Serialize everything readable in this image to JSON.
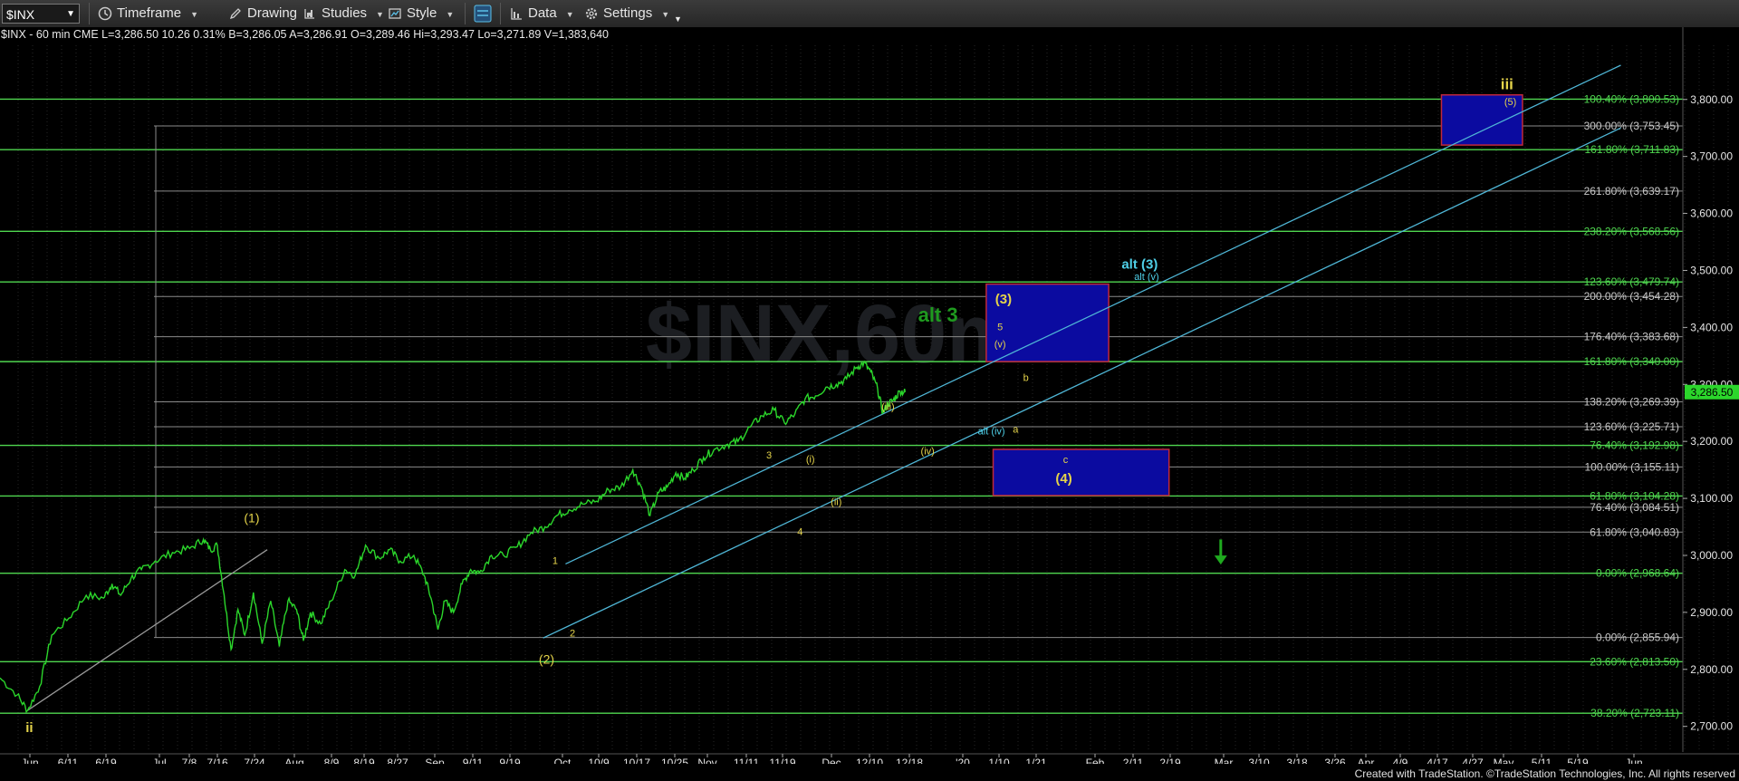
{
  "toolbar": {
    "symbol": "$INX",
    "timeframe": "Timeframe",
    "drawing": "Drawing",
    "studies": "Studies",
    "style": "Style",
    "data": "Data",
    "settings": "Settings"
  },
  "quote_line": "$INX - 60 min  CME  L=3,286.50  10.26  0.31%  B=3,286.05  A=3,286.91  O=3,289.46  Hi=3,293.47  Lo=3,271.89  V=1,383,640",
  "credit": "Created with TradeStation. ©TradeStation Technologies, Inc. All rights reserved",
  "colors": {
    "price": "#2bd62b",
    "green_line": "#4fd64f",
    "gray_line": "#8a8a8a",
    "channel": "#4fb6d6",
    "wave_yellow": "#e5d44a",
    "wave_cyan": "#4fd0e8",
    "box_fill": "#0b0ba0",
    "box_border": "#c0283a",
    "last_price_bg": "#2bd62b"
  },
  "chart_data": {
    "type": "line",
    "symbol": "$INX",
    "interval": "60 min",
    "x_tick_labels": [
      "Jun",
      "6/11",
      "6/19",
      "Jul",
      "7/8",
      "7/16",
      "7/24",
      "Aug",
      "8/9",
      "8/19",
      "8/27",
      "Sep",
      "9/11",
      "9/19",
      "Oct",
      "10/9",
      "10/17",
      "10/25",
      "Nov",
      "11/11",
      "11/19",
      "Dec",
      "12/10",
      "12/18",
      "'20",
      "1/10",
      "1/21",
      "Feb",
      "2/11",
      "2/19",
      "Mar",
      "3/10",
      "3/18",
      "3/26",
      "Apr",
      "4/9",
      "4/17",
      "4/27",
      "May",
      "5/11",
      "5/19",
      "Jun"
    ],
    "y_ticks": [
      2700,
      2800,
      2900,
      3000,
      3100,
      3200,
      3300,
      3400,
      3500,
      3600,
      3700,
      3800
    ],
    "y_tick_labels": [
      "2,700.00",
      "2,800.00",
      "2,900.00",
      "3,000.00",
      "3,100.00",
      "3,200.00",
      "3,300.00",
      "3,400.00",
      "3,500.00",
      "3,600.00",
      "3,700.00",
      "3,800.00"
    ],
    "ylim": [
      2655,
      3895
    ],
    "last_price": 3286.5,
    "last_price_label": "3,286.50",
    "price_series": [
      {
        "t": 0,
        "v": 2785
      },
      {
        "t": 1,
        "v": 2755
      },
      {
        "t": 1.6,
        "v": 2728
      },
      {
        "t": 2.3,
        "v": 2770
      },
      {
        "t": 3,
        "v": 2860
      },
      {
        "t": 4,
        "v": 2890
      },
      {
        "t": 5,
        "v": 2930
      },
      {
        "t": 6,
        "v": 2925
      },
      {
        "t": 6.5,
        "v": 2950
      },
      {
        "t": 7,
        "v": 2930
      },
      {
        "t": 7.6,
        "v": 2960
      },
      {
        "t": 8.2,
        "v": 2975
      },
      {
        "t": 9,
        "v": 2990
      },
      {
        "t": 10,
        "v": 3005
      },
      {
        "t": 11,
        "v": 3012
      },
      {
        "t": 11.8,
        "v": 3028
      },
      {
        "t": 12.2,
        "v": 3010
      },
      {
        "t": 12.6,
        "v": 3018
      },
      {
        "t": 13,
        "v": 2930
      },
      {
        "t": 13.4,
        "v": 2835
      },
      {
        "t": 13.8,
        "v": 2905
      },
      {
        "t": 14.2,
        "v": 2860
      },
      {
        "t": 14.7,
        "v": 2935
      },
      {
        "t": 15.2,
        "v": 2845
      },
      {
        "t": 15.7,
        "v": 2920
      },
      {
        "t": 16.2,
        "v": 2840
      },
      {
        "t": 16.7,
        "v": 2920
      },
      {
        "t": 17.2,
        "v": 2905
      },
      {
        "t": 17.6,
        "v": 2850
      },
      {
        "t": 18,
        "v": 2900
      },
      {
        "t": 18.6,
        "v": 2880
      },
      {
        "t": 19.2,
        "v": 2920
      },
      {
        "t": 20,
        "v": 2975
      },
      {
        "t": 20.6,
        "v": 2965
      },
      {
        "t": 21.2,
        "v": 3018
      },
      {
        "t": 22,
        "v": 2995
      },
      {
        "t": 22.6,
        "v": 3010
      },
      {
        "t": 23.2,
        "v": 2990
      },
      {
        "t": 24,
        "v": 3000
      },
      {
        "t": 24.6,
        "v": 2965
      },
      {
        "t": 25,
        "v": 2925
      },
      {
        "t": 25.4,
        "v": 2870
      },
      {
        "t": 25.8,
        "v": 2920
      },
      {
        "t": 26.3,
        "v": 2900
      },
      {
        "t": 26.8,
        "v": 2950
      },
      {
        "t": 27.3,
        "v": 2975
      },
      {
        "t": 27.8,
        "v": 2970
      },
      {
        "t": 28.5,
        "v": 3000
      },
      {
        "t": 29.2,
        "v": 3000
      },
      {
        "t": 30,
        "v": 3015
      },
      {
        "t": 30.8,
        "v": 3040
      },
      {
        "t": 31.6,
        "v": 3050
      },
      {
        "t": 32.3,
        "v": 3070
      },
      {
        "t": 33,
        "v": 3080
      },
      {
        "t": 33.8,
        "v": 3090
      },
      {
        "t": 34.6,
        "v": 3095
      },
      {
        "t": 35.3,
        "v": 3115
      },
      {
        "t": 36,
        "v": 3120
      },
      {
        "t": 36.7,
        "v": 3150
      },
      {
        "t": 37.2,
        "v": 3120
      },
      {
        "t": 37.7,
        "v": 3070
      },
      {
        "t": 38.2,
        "v": 3110
      },
      {
        "t": 38.7,
        "v": 3120
      },
      {
        "t": 39.2,
        "v": 3145
      },
      {
        "t": 39.7,
        "v": 3135
      },
      {
        "t": 40.2,
        "v": 3150
      },
      {
        "t": 40.8,
        "v": 3172
      },
      {
        "t": 41.4,
        "v": 3185
      },
      {
        "t": 42.2,
        "v": 3195
      },
      {
        "t": 42.8,
        "v": 3200
      },
      {
        "t": 43.5,
        "v": 3225
      },
      {
        "t": 44.2,
        "v": 3245
      },
      {
        "t": 44.9,
        "v": 3255
      },
      {
        "t": 45.5,
        "v": 3232
      },
      {
        "t": 46.1,
        "v": 3248
      },
      {
        "t": 46.7,
        "v": 3275
      },
      {
        "t": 47.3,
        "v": 3280
      },
      {
        "t": 47.9,
        "v": 3295
      },
      {
        "t": 48.5,
        "v": 3300
      },
      {
        "t": 49.1,
        "v": 3310
      },
      {
        "t": 49.7,
        "v": 3330
      },
      {
        "t": 50.1,
        "v": 3338
      },
      {
        "t": 50.5,
        "v": 3322
      },
      {
        "t": 50.9,
        "v": 3292
      },
      {
        "t": 51.2,
        "v": 3250
      },
      {
        "t": 51.5,
        "v": 3266
      },
      {
        "t": 51.8,
        "v": 3272
      },
      {
        "t": 52.2,
        "v": 3288
      },
      {
        "t": 52.5,
        "v": 3286.5
      }
    ],
    "horizontal_levels": [
      {
        "value": 3800.53,
        "label": "100.40% (3,800.53)",
        "color": "green"
      },
      {
        "value": 3753.45,
        "label": "300.00% (3,753.45)",
        "color": "gray"
      },
      {
        "value": 3711.83,
        "label": "161.80% (3,711.83)",
        "color": "green"
      },
      {
        "value": 3639.17,
        "label": "261.80% (3,639.17)",
        "color": "gray"
      },
      {
        "value": 3568.56,
        "label": "238.20% (3,568.56)",
        "color": "green"
      },
      {
        "value": 3479.74,
        "label": "123.60% (3,479.74)",
        "color": "green"
      },
      {
        "value": 3454.28,
        "label": "200.00% (3,454.28)",
        "color": "gray"
      },
      {
        "value": 3383.68,
        "label": "176.40% (3,383.68)",
        "color": "gray"
      },
      {
        "value": 3340.0,
        "label": "161.80% (3,340.00)",
        "color": "green"
      },
      {
        "value": 3269.39,
        "label": "138.20% (3,269.39)",
        "color": "gray"
      },
      {
        "value": 3225.71,
        "label": "123.60% (3,225.71)",
        "color": "gray"
      },
      {
        "value": 3192.98,
        "label": "76.40% (3,192.98)",
        "color": "green"
      },
      {
        "value": 3155.11,
        "label": "100.00% (3,155.11)",
        "color": "gray"
      },
      {
        "value": 3104.28,
        "label": "61.80% (3,104.28)",
        "color": "green"
      },
      {
        "value": 3084.51,
        "label": "76.40% (3,084.51)",
        "color": "gray"
      },
      {
        "value": 3040.83,
        "label": "61.80% (3,040.83)",
        "color": "gray"
      },
      {
        "value": 2968.64,
        "label": "0.00% (2,968.64)",
        "color": "green"
      },
      {
        "value": 2855.94,
        "label": "0.00% (2,855.94)",
        "color": "gray"
      },
      {
        "value": 2813.5,
        "label": "23.60% (2,813.50)",
        "color": "green"
      },
      {
        "value": 2723.11,
        "label": "38.20% (2,723.11)",
        "color": "green"
      }
    ],
    "zones": [
      {
        "t0": 57.2,
        "t1": 64.3,
        "v0": 3340,
        "v1": 3476
      },
      {
        "t0": 57.6,
        "t1": 67.8,
        "v0": 3105,
        "v1": 3186
      },
      {
        "t0": 83.6,
        "t1": 88.3,
        "v0": 3720,
        "v1": 3808
      }
    ],
    "trendlines": [
      {
        "t0": 1.6,
        "v0": 2728,
        "t1": 15.5,
        "v1": 3010,
        "color": "gray"
      },
      {
        "t0": 32.8,
        "v0": 2985,
        "t1": 94,
        "v1": 3860,
        "color": "cyan"
      },
      {
        "t0": 31.5,
        "v0": 2855,
        "t1": 94,
        "v1": 3750,
        "color": "cyan"
      }
    ],
    "wave_labels": [
      {
        "text": "ii",
        "t": 1.7,
        "v": 2690,
        "color": "yellow",
        "size": 15
      },
      {
        "text": "(1)",
        "t": 14.6,
        "v": 3058,
        "color": "yellow",
        "size": 14
      },
      {
        "text": "(2)",
        "t": 31.7,
        "v": 2810,
        "color": "yellow",
        "size": 14
      },
      {
        "text": "1",
        "t": 32.2,
        "v": 2985,
        "color": "yellow",
        "size": 11
      },
      {
        "text": "2",
        "t": 33.2,
        "v": 2858,
        "color": "yellow",
        "size": 11
      },
      {
        "text": "3",
        "t": 44.6,
        "v": 3170,
        "color": "yellow",
        "size": 11
      },
      {
        "text": "4",
        "t": 46.4,
        "v": 3036,
        "color": "yellow",
        "size": 11
      },
      {
        "text": "(i)",
        "t": 47.0,
        "v": 3163,
        "color": "yellow",
        "size": 11
      },
      {
        "text": "(ii)",
        "t": 48.5,
        "v": 3088,
        "color": "yellow",
        "size": 11
      },
      {
        "text": "(iii)",
        "t": 51.5,
        "v": 3255,
        "color": "yellow",
        "size": 11
      },
      {
        "text": "(iv)",
        "t": 53.8,
        "v": 3177,
        "color": "yellow",
        "size": 11
      },
      {
        "text": "(v)",
        "t": 58.0,
        "v": 3365,
        "color": "yellow",
        "size": 11
      },
      {
        "text": "5",
        "t": 58.0,
        "v": 3395,
        "color": "yellow",
        "size": 11
      },
      {
        "text": "(3)",
        "t": 58.2,
        "v": 3442,
        "color": "yellow",
        "size": 15
      },
      {
        "text": "b",
        "t": 59.5,
        "v": 3306,
        "color": "yellow",
        "size": 11
      },
      {
        "text": "a",
        "t": 58.9,
        "v": 3215,
        "color": "yellow",
        "size": 11
      },
      {
        "text": "alt (iv)",
        "t": 57.5,
        "v": 3212,
        "color": "cyan",
        "size": 11
      },
      {
        "text": "c",
        "t": 61.8,
        "v": 3162,
        "color": "yellow",
        "size": 11
      },
      {
        "text": "(4)",
        "t": 61.7,
        "v": 3127,
        "color": "yellow",
        "size": 15
      },
      {
        "text": "alt (3)",
        "t": 66.1,
        "v": 3503,
        "color": "cyan",
        "size": 15
      },
      {
        "text": "alt (v)",
        "t": 66.5,
        "v": 3483,
        "color": "cyan",
        "size": 11
      },
      {
        "text": "alt 3",
        "t": 54.4,
        "v": 3410,
        "color": "green",
        "size": 22
      },
      {
        "text": "iii",
        "t": 87.4,
        "v": 3818,
        "color": "yellow",
        "size": 17
      },
      {
        "text": "(5)",
        "t": 87.6,
        "v": 3790,
        "color": "yellow",
        "size": 11
      }
    ],
    "arrow": {
      "t": 70.8,
      "v_top": 3028,
      "v_bottom": 2987
    }
  }
}
